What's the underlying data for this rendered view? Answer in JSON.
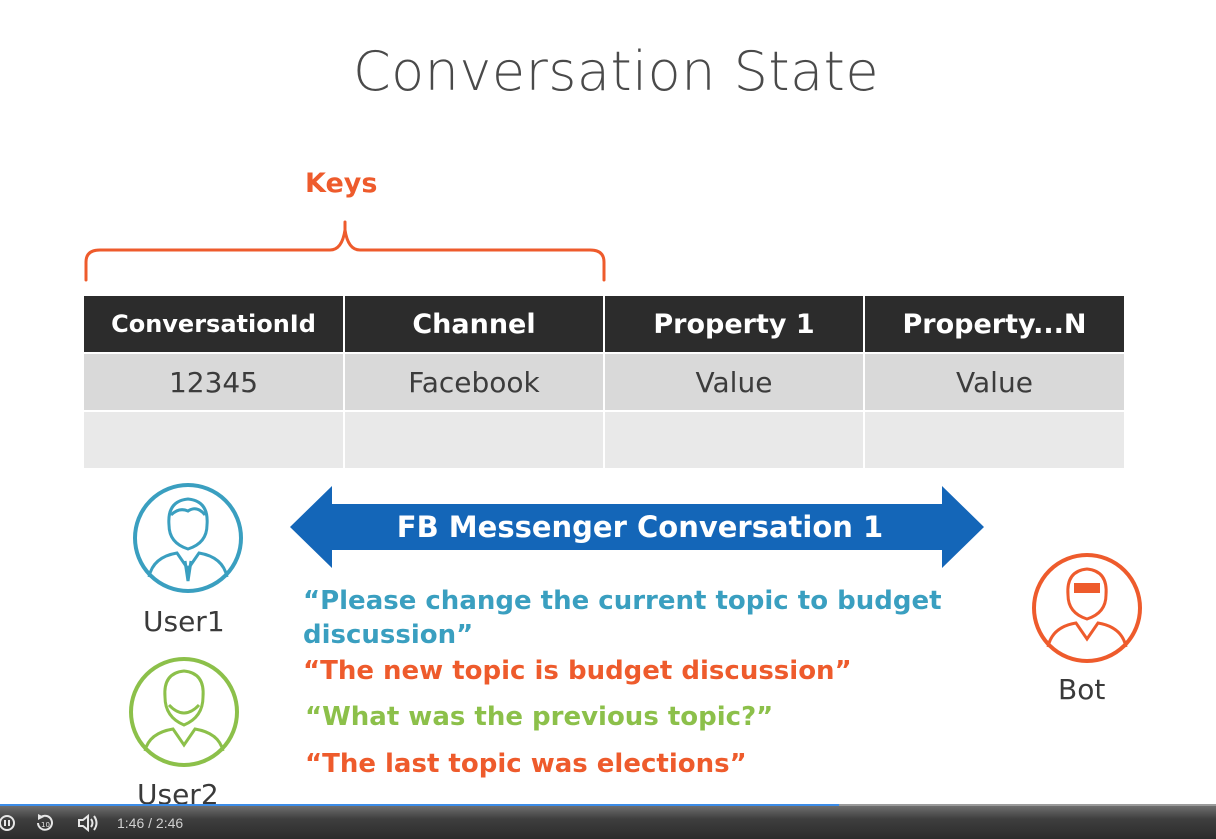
{
  "slide": {
    "title": "Conversation State",
    "keys_label": "Keys",
    "table": {
      "headers": [
        "ConversationId",
        "Channel",
        "Property 1",
        "Property...N"
      ],
      "rows": [
        [
          "12345",
          "Facebook",
          "Value",
          "Value"
        ],
        [
          "",
          "",
          "",
          ""
        ]
      ]
    },
    "arrow_label": "FB Messenger Conversation 1",
    "users": {
      "user1": "User1",
      "user2": "User2",
      "bot": "Bot"
    },
    "messages": [
      {
        "text": "“Please change the current topic to budget discussion”",
        "color": "#3a9fc0"
      },
      {
        "text": "“The new topic is budget discussion”",
        "color": "#ee5b2c"
      },
      {
        "text": "“What was the previous topic?”",
        "color": "#8cc04a"
      },
      {
        "text": "“The last topic was elections”",
        "color": "#ee5b2c"
      }
    ],
    "colors": {
      "keys": "#ee5b2c",
      "header_bg": "#2c2c2c",
      "cell_bg": "#d9d9d9",
      "arrow": "#1466b8",
      "user1": "#3a9fc0",
      "user2": "#8cc04a",
      "bot": "#ee5b2c"
    }
  },
  "player": {
    "time": "1:46 / 2:46",
    "progress_percent": 69,
    "icons": [
      "play-pause-icon",
      "rewind-10-icon",
      "volume-icon"
    ]
  }
}
